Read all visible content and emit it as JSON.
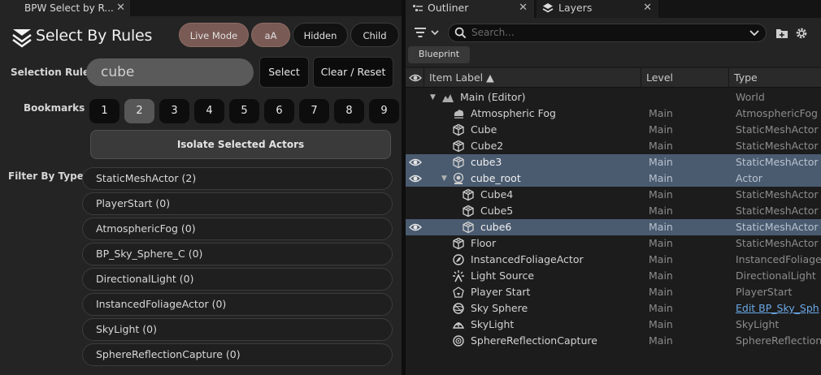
{
  "left_panel": {
    "tab_title": "BPW Select by R...",
    "tab_close": "✕",
    "title": "Select By Rules",
    "mode_buttons": [
      {
        "label": "Live Mode",
        "active": true
      },
      {
        "label": "aA",
        "active": true
      },
      {
        "label": "Hidden",
        "active": false
      },
      {
        "label": "Child",
        "active": false
      }
    ],
    "selection_rule_label": "Selection Rule",
    "rule_value": "cube",
    "select_label": "Select",
    "clear_label": "Clear / Reset",
    "bookmarks_label": "Bookmarks",
    "bookmarks": [
      "1",
      "2",
      "3",
      "4",
      "5",
      "6",
      "7",
      "8",
      "9"
    ],
    "active_bookmark": "2",
    "isolate_label": "Isolate Selected Actors",
    "filter_label": "Filter By Types",
    "types": [
      "StaticMeshActor  (2)",
      "PlayerStart  (0)",
      "AtmosphericFog  (0)",
      "BP_Sky_Sphere_C  (0)",
      "DirectionalLight  (0)",
      "InstancedFoliageActor  (0)",
      "SkyLight  (0)",
      "SphereReflectionCapture  (0)"
    ]
  },
  "outliner": {
    "tabs": [
      {
        "label": "Outliner",
        "close": "✕"
      },
      {
        "label": "Layers",
        "close": "✕"
      }
    ],
    "search_placeholder": "Search...",
    "blueprint_label": "Blueprint",
    "columns": {
      "label": "Item Label ▲",
      "level": "Level",
      "type": "Type"
    },
    "rows": [
      {
        "label": "Main (Editor)",
        "level": "",
        "type": "World",
        "icon": "world-icon",
        "depth": 0,
        "expander": "▼",
        "selected": false,
        "eye": false
      },
      {
        "label": "Atmospheric Fog",
        "level": "Main",
        "type": "AtmosphericFog",
        "icon": "fog-icon",
        "depth": 1,
        "selected": false,
        "eye": false
      },
      {
        "label": "Cube",
        "level": "Main",
        "type": "StaticMeshActor",
        "icon": "mesh-icon",
        "depth": 1,
        "selected": false,
        "eye": false
      },
      {
        "label": "Cube2",
        "level": "Main",
        "type": "StaticMeshActor",
        "icon": "mesh-icon",
        "depth": 1,
        "selected": false,
        "eye": false
      },
      {
        "label": "cube3",
        "level": "Main",
        "type": "StaticMeshActor",
        "icon": "mesh-icon",
        "depth": 1,
        "selected": true,
        "eye": true
      },
      {
        "label": "cube_root",
        "level": "Main",
        "type": "Actor",
        "icon": "actor-icon",
        "depth": 1,
        "expander": "▼",
        "selected": true,
        "eye": true
      },
      {
        "label": "Cube4",
        "level": "Main",
        "type": "StaticMeshActor",
        "icon": "mesh-icon",
        "depth": 2,
        "selected": false,
        "eye": false
      },
      {
        "label": "Cube5",
        "level": "Main",
        "type": "StaticMeshActor",
        "icon": "mesh-icon",
        "depth": 2,
        "selected": false,
        "eye": false
      },
      {
        "label": "cube6",
        "level": "Main",
        "type": "StaticMeshActor",
        "icon": "mesh-icon",
        "depth": 2,
        "selected": true,
        "eye": true
      },
      {
        "label": "Floor",
        "level": "Main",
        "type": "StaticMeshActor",
        "icon": "mesh-icon",
        "depth": 1,
        "selected": false,
        "eye": false
      },
      {
        "label": "InstancedFoliageActor",
        "level": "Main",
        "type": "InstancedFoliage",
        "icon": "foliage-icon",
        "depth": 1,
        "selected": false,
        "eye": false
      },
      {
        "label": "Light Source",
        "level": "Main",
        "type": "DirectionalLight",
        "icon": "light-icon",
        "depth": 1,
        "selected": false,
        "eye": false
      },
      {
        "label": "Player Start",
        "level": "Main",
        "type": "PlayerStart",
        "icon": "player-start-icon",
        "depth": 1,
        "selected": false,
        "eye": false
      },
      {
        "label": "Sky Sphere",
        "level": "Main",
        "type": "Edit BP_Sky_Sph",
        "type_is_link": true,
        "icon": "sky-sphere-icon",
        "depth": 1,
        "selected": false,
        "eye": false
      },
      {
        "label": "SkyLight",
        "level": "Main",
        "type": "SkyLight",
        "icon": "skylight-icon",
        "depth": 1,
        "selected": false,
        "eye": false
      },
      {
        "label": "SphereReflectionCapture",
        "level": "Main",
        "type": "SphereReflection",
        "icon": "reflection-icon",
        "depth": 1,
        "selected": false,
        "eye": false
      }
    ]
  }
}
